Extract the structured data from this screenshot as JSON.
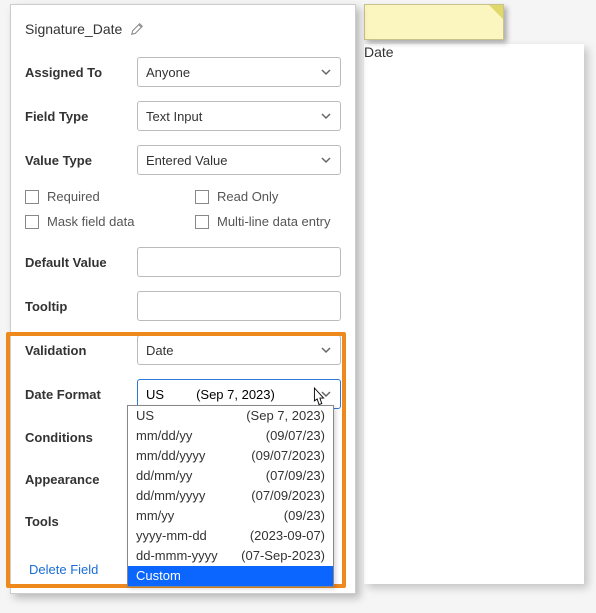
{
  "title": "Signature_Date",
  "preview_label": "Date",
  "fields": {
    "assigned_to": {
      "label": "Assigned To",
      "value": "Anyone"
    },
    "field_type": {
      "label": "Field Type",
      "value": "Text Input"
    },
    "value_type": {
      "label": "Value Type",
      "value": "Entered Value"
    },
    "default_value": {
      "label": "Default Value"
    },
    "tooltip": {
      "label": "Tooltip"
    },
    "validation": {
      "label": "Validation",
      "value": "Date"
    },
    "date_format": {
      "label": "Date Format",
      "selected_name": "US",
      "selected_sample": "(Sep 7, 2023)"
    }
  },
  "checks": {
    "required": "Required",
    "readonly": "Read Only",
    "mask": "Mask field data",
    "multiline": "Multi-line data entry"
  },
  "sections": {
    "conditions": "Conditions",
    "appearance": "Appearance",
    "tools": "Tools"
  },
  "options": [
    {
      "name": "US",
      "sample": "(Sep 7, 2023)"
    },
    {
      "name": "mm/dd/yy",
      "sample": "(09/07/23)"
    },
    {
      "name": "mm/dd/yyyy",
      "sample": "(09/07/2023)"
    },
    {
      "name": "dd/mm/yy",
      "sample": "(07/09/23)"
    },
    {
      "name": "dd/mm/yyyy",
      "sample": "(07/09/2023)"
    },
    {
      "name": "mm/yy",
      "sample": "(09/23)"
    },
    {
      "name": "yyyy-mm-dd",
      "sample": "(2023-09-07)"
    },
    {
      "name": "dd-mmm-yyyy",
      "sample": "(07-Sep-2023)"
    },
    {
      "name": "Custom",
      "sample": ""
    }
  ],
  "delete_label": "Delete Field"
}
